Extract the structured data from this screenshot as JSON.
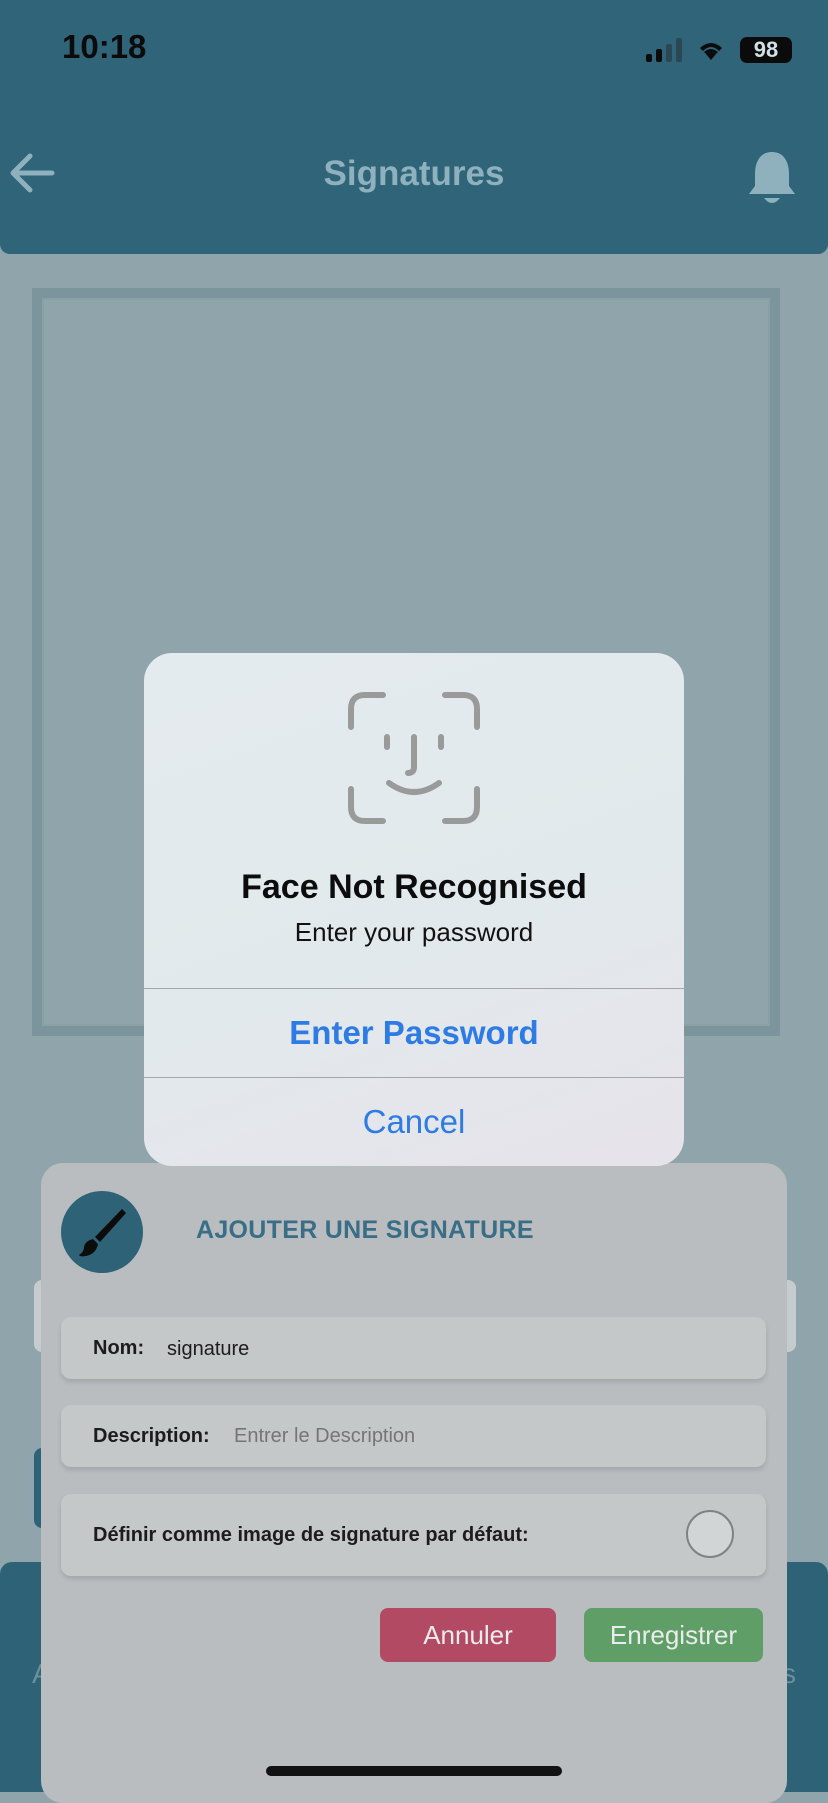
{
  "status_bar": {
    "time": "10:18",
    "battery": "98"
  },
  "header": {
    "title": "Signatures"
  },
  "face_alert": {
    "title": "Face Not Recognised",
    "message": "Enter your password",
    "primary_action": "Enter Password",
    "cancel_action": "Cancel"
  },
  "sheet": {
    "title": "AJOUTER UNE SIGNATURE",
    "name_label": "Nom:",
    "name_value": "signature",
    "description_label": "Description:",
    "description_placeholder": "Entrer le Description",
    "default_label": "Définir comme image de signature par défaut:",
    "default_checked": false,
    "cancel_label": "Annuler",
    "save_label": "Enregistrer"
  },
  "background": {
    "bottom_left_text": "A",
    "bottom_right_text": "s"
  },
  "colors": {
    "header": "#2f6479",
    "alert_button": "#2d7be5",
    "cancel_button": "#b34a63",
    "save_button": "#5f9e66"
  }
}
